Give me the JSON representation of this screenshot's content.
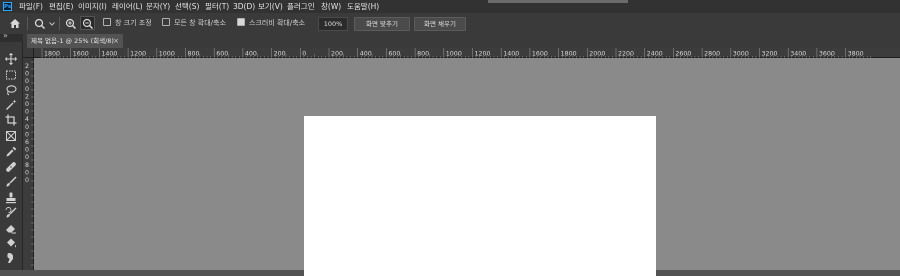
{
  "app": {
    "logo": "Ps"
  },
  "menu": [
    "파일(F)",
    "편집(E)",
    "이미지(I)",
    "레이어(L)",
    "문자(Y)",
    "선택(S)",
    "필터(T)",
    "3D(D)",
    "보기(V)",
    "플러그인",
    "창(W)",
    "도움말(H)"
  ],
  "options": {
    "resize_windows": {
      "label": "창 크기 조정",
      "checked": false
    },
    "zoom_all_windows": {
      "label": "모든 창 확대/축소",
      "checked": false
    },
    "scrubby_zoom": {
      "label": "스크러비 확대/축소",
      "checked": true
    },
    "zoom_value": "100%",
    "fit_screen": "화면 맞추기",
    "fill_screen": "화면 채우기"
  },
  "document_tab": {
    "title": "제목 없음-1 @ 25% (회색/8)",
    "close": "×"
  },
  "ruler_h": [
    "1800",
    "1600",
    "1400",
    "1200",
    "1000",
    "800",
    "600",
    "400",
    "200",
    "0",
    "200",
    "400",
    "600",
    "800",
    "1000",
    "1200",
    "1400",
    "1600",
    "1800",
    "2000",
    "2200",
    "2400",
    "2600",
    "2800",
    "3000",
    "3200",
    "3400",
    "3600",
    "3800"
  ],
  "ruler_v": [
    "2",
    "0",
    "0",
    "0",
    "2",
    "0",
    "0",
    "4",
    "0",
    "0",
    "6",
    "0",
    "0",
    "8",
    "0",
    "0"
  ],
  "tool_icons": [
    "move-icon",
    "marquee-icon",
    "lasso-icon",
    "magic-wand-icon",
    "crop-icon",
    "frame-icon",
    "eyedropper-icon",
    "healing-brush-icon",
    "brush-icon",
    "clone-stamp-icon",
    "history-brush-icon",
    "eraser-icon",
    "paint-bucket-icon",
    "smudge-icon"
  ],
  "colors": {
    "menubar": "#323232",
    "panel": "#3a3a3a",
    "canvas_bg": "#8a8a8a",
    "document": "#ffffff",
    "brand": "#31a8ff"
  }
}
